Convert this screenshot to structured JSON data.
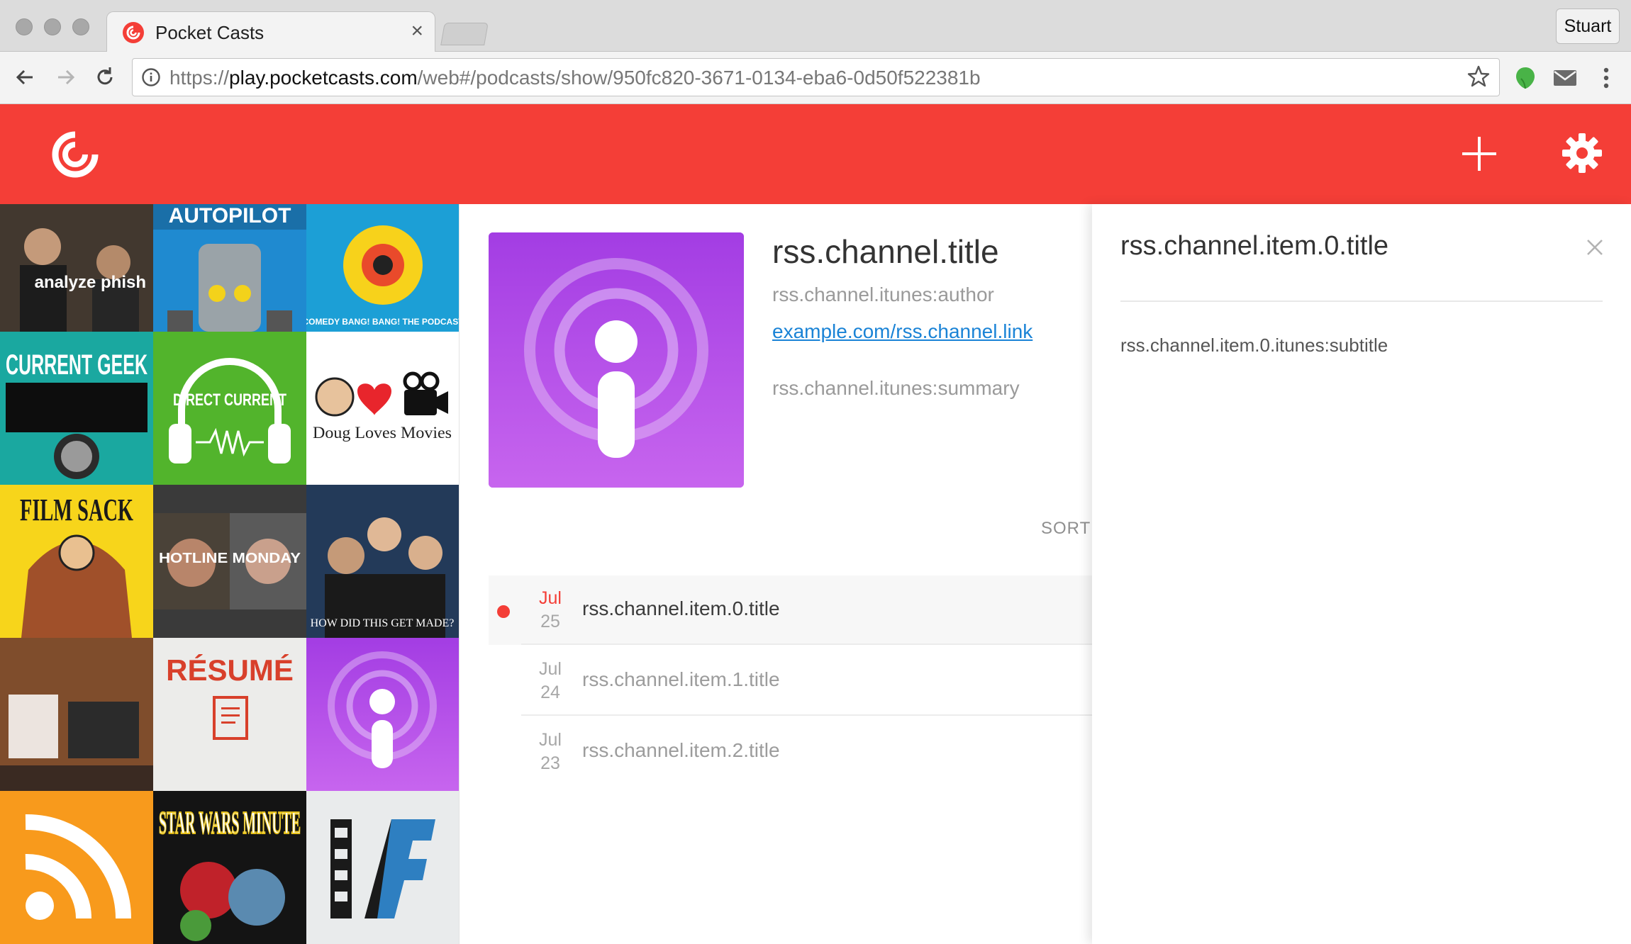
{
  "browser": {
    "tab_title": "Pocket Casts",
    "tab_close": "×",
    "profile_name": "Stuart",
    "url_scheme": "https://",
    "url_host": "play.pocketcasts.com",
    "url_path": "/web#/podcasts/show/950fc820-3671-0134-eba6-0d50f522381b"
  },
  "theme": {
    "brand": "#f43e37",
    "podcast_gradient_top": "#a33de3",
    "podcast_gradient_bottom": "#c765ee"
  },
  "grid_titles": [
    "analyze phish",
    "AUTOPILOT",
    "COMEDY BANG! BANG! THE PODCAST",
    "CURRENT GEEK",
    "DIRECT CURRENT",
    "Doug Loves Movies",
    "FILM SACK",
    "HOTLINE MONDAY",
    "HOW DID THIS GET MADE?",
    "RÉSUMÉ",
    "STAR WARS MINUTE"
  ],
  "podcast": {
    "title": "rss.channel.title",
    "author": "rss.channel.itunes:author",
    "link": "example.com/rss.channel.link",
    "summary": "rss.channel.itunes:summary",
    "sort_label": "SORT BY"
  },
  "episodes": [
    {
      "month": "Jul",
      "day": "25",
      "title": "rss.channel.item.0.title"
    },
    {
      "month": "Jul",
      "day": "24",
      "title": "rss.channel.item.1.title"
    },
    {
      "month": "Jul",
      "day": "23",
      "title": "rss.channel.item.2.title"
    }
  ],
  "panel": {
    "title": "rss.channel.item.0.title",
    "subtitle": "rss.channel.item.0.itunes:subtitle"
  }
}
